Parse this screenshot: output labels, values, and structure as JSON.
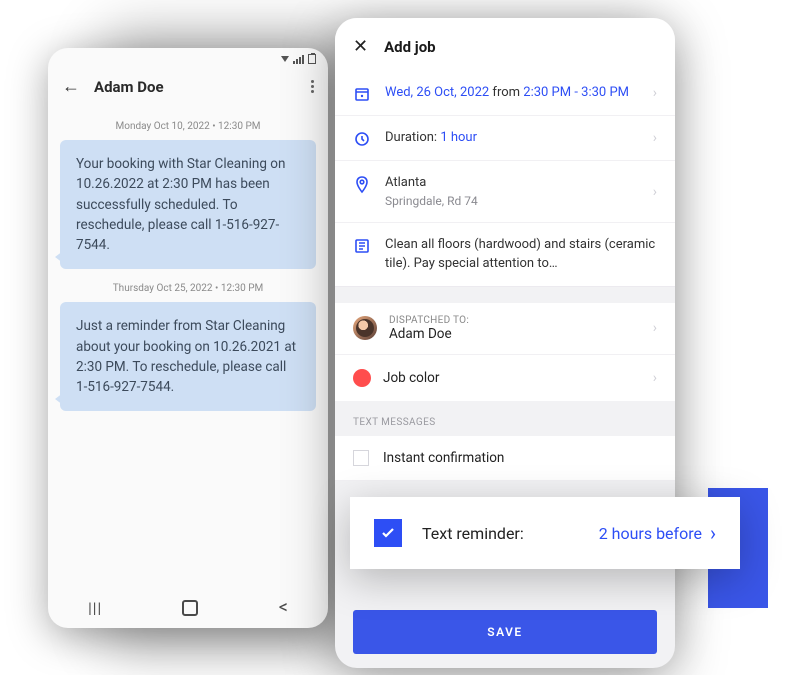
{
  "chat": {
    "contact_name": "Adam Doe",
    "messages": [
      {
        "timestamp": "Monday Oct 10, 2022 • 12:30 PM",
        "text": "Your booking with Star Cleaning on 10.26.2022 at 2:30 PM has been successfully scheduled. To reschedule, please call 1-516-927-7544."
      },
      {
        "timestamp": "Thursday Oct 25, 2022 • 12:30 PM",
        "text": "Just a reminder from Star Cleaning about your booking on 10.26.2021 at 2:30 PM. To reschedule, please call 1-516-927-7544."
      }
    ]
  },
  "job": {
    "screen_title": "Add job",
    "date": "Wed, 26 Oct, 2022",
    "date_sep": " from ",
    "time": "2:30 PM - 3:30 PM",
    "duration_label": "Duration: ",
    "duration_value": "1 hour",
    "location_city": "Atlanta",
    "location_addr": "Springdale, Rd 74",
    "notes": "Clean all floors (hardwood) and stairs (ceramic tile). Pay special attention to…",
    "dispatched_label": "DISPATCHED TO:",
    "dispatched_name": "Adam Doe",
    "color_label": "Job color",
    "job_color": "#ff4d4d",
    "text_messages_section": "TEXT MESSAGES",
    "instant_confirmation": "Instant confirmation",
    "save": "SAVE"
  },
  "reminder": {
    "label": "Text reminder:",
    "value": "2 hours before"
  }
}
